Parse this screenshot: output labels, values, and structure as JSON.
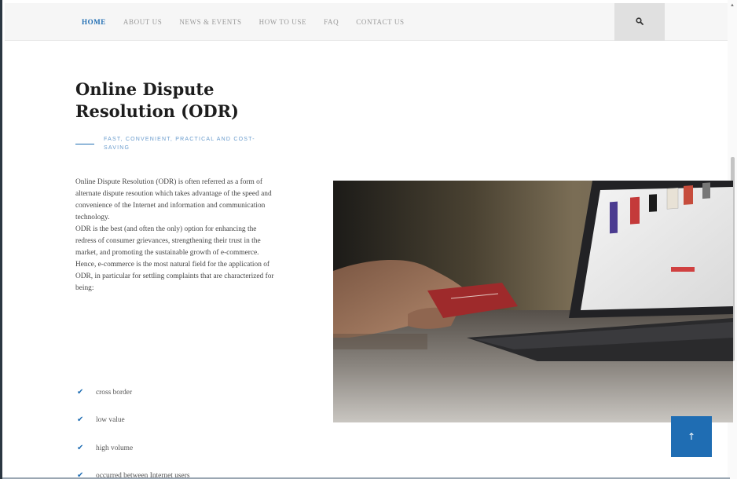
{
  "nav": {
    "items": [
      {
        "label": "HOME",
        "active": true
      },
      {
        "label": "ABOUT US",
        "active": false
      },
      {
        "label": "NEWS & EVENTS",
        "active": false
      },
      {
        "label": "HOW TO USE",
        "active": false
      },
      {
        "label": "FAQ",
        "active": false
      },
      {
        "label": "CONTACT US",
        "active": false
      }
    ],
    "search_icon": "search-icon"
  },
  "main": {
    "title": "Online Dispute Resolution (ODR)",
    "subtitle": "FAST, CONVENIENT, PRACTICAL AND COST-SAVING",
    "paragraph_1": "Online Dispute Resolution (ODR) is often referred as a form of alternate dispute resoution which takes advantage of the speed and convenience of the Internet and information and communication technology.",
    "paragraph_2": "ODR is the best (and often the only) option for enhancing the redress of consumer grievances, strengthening their trust in the market, and promoting the sustainable growth of e-commerce. Hence, e-commerce is the most natural field for the application of ODR, in particular for settling complaints that are characterized for being:",
    "checklist": [
      "cross border",
      "low value",
      "high volume",
      "occurred between Internet users"
    ],
    "check_icon": "checkmark-icon"
  },
  "back_to_top": {
    "label": "↑",
    "icon": "arrow-up-icon"
  },
  "colors": {
    "accent": "#1f6db3",
    "nav_bg": "#f6f6f6",
    "search_bg": "#e0e0e0",
    "subtitle": "#6a9ccd"
  }
}
